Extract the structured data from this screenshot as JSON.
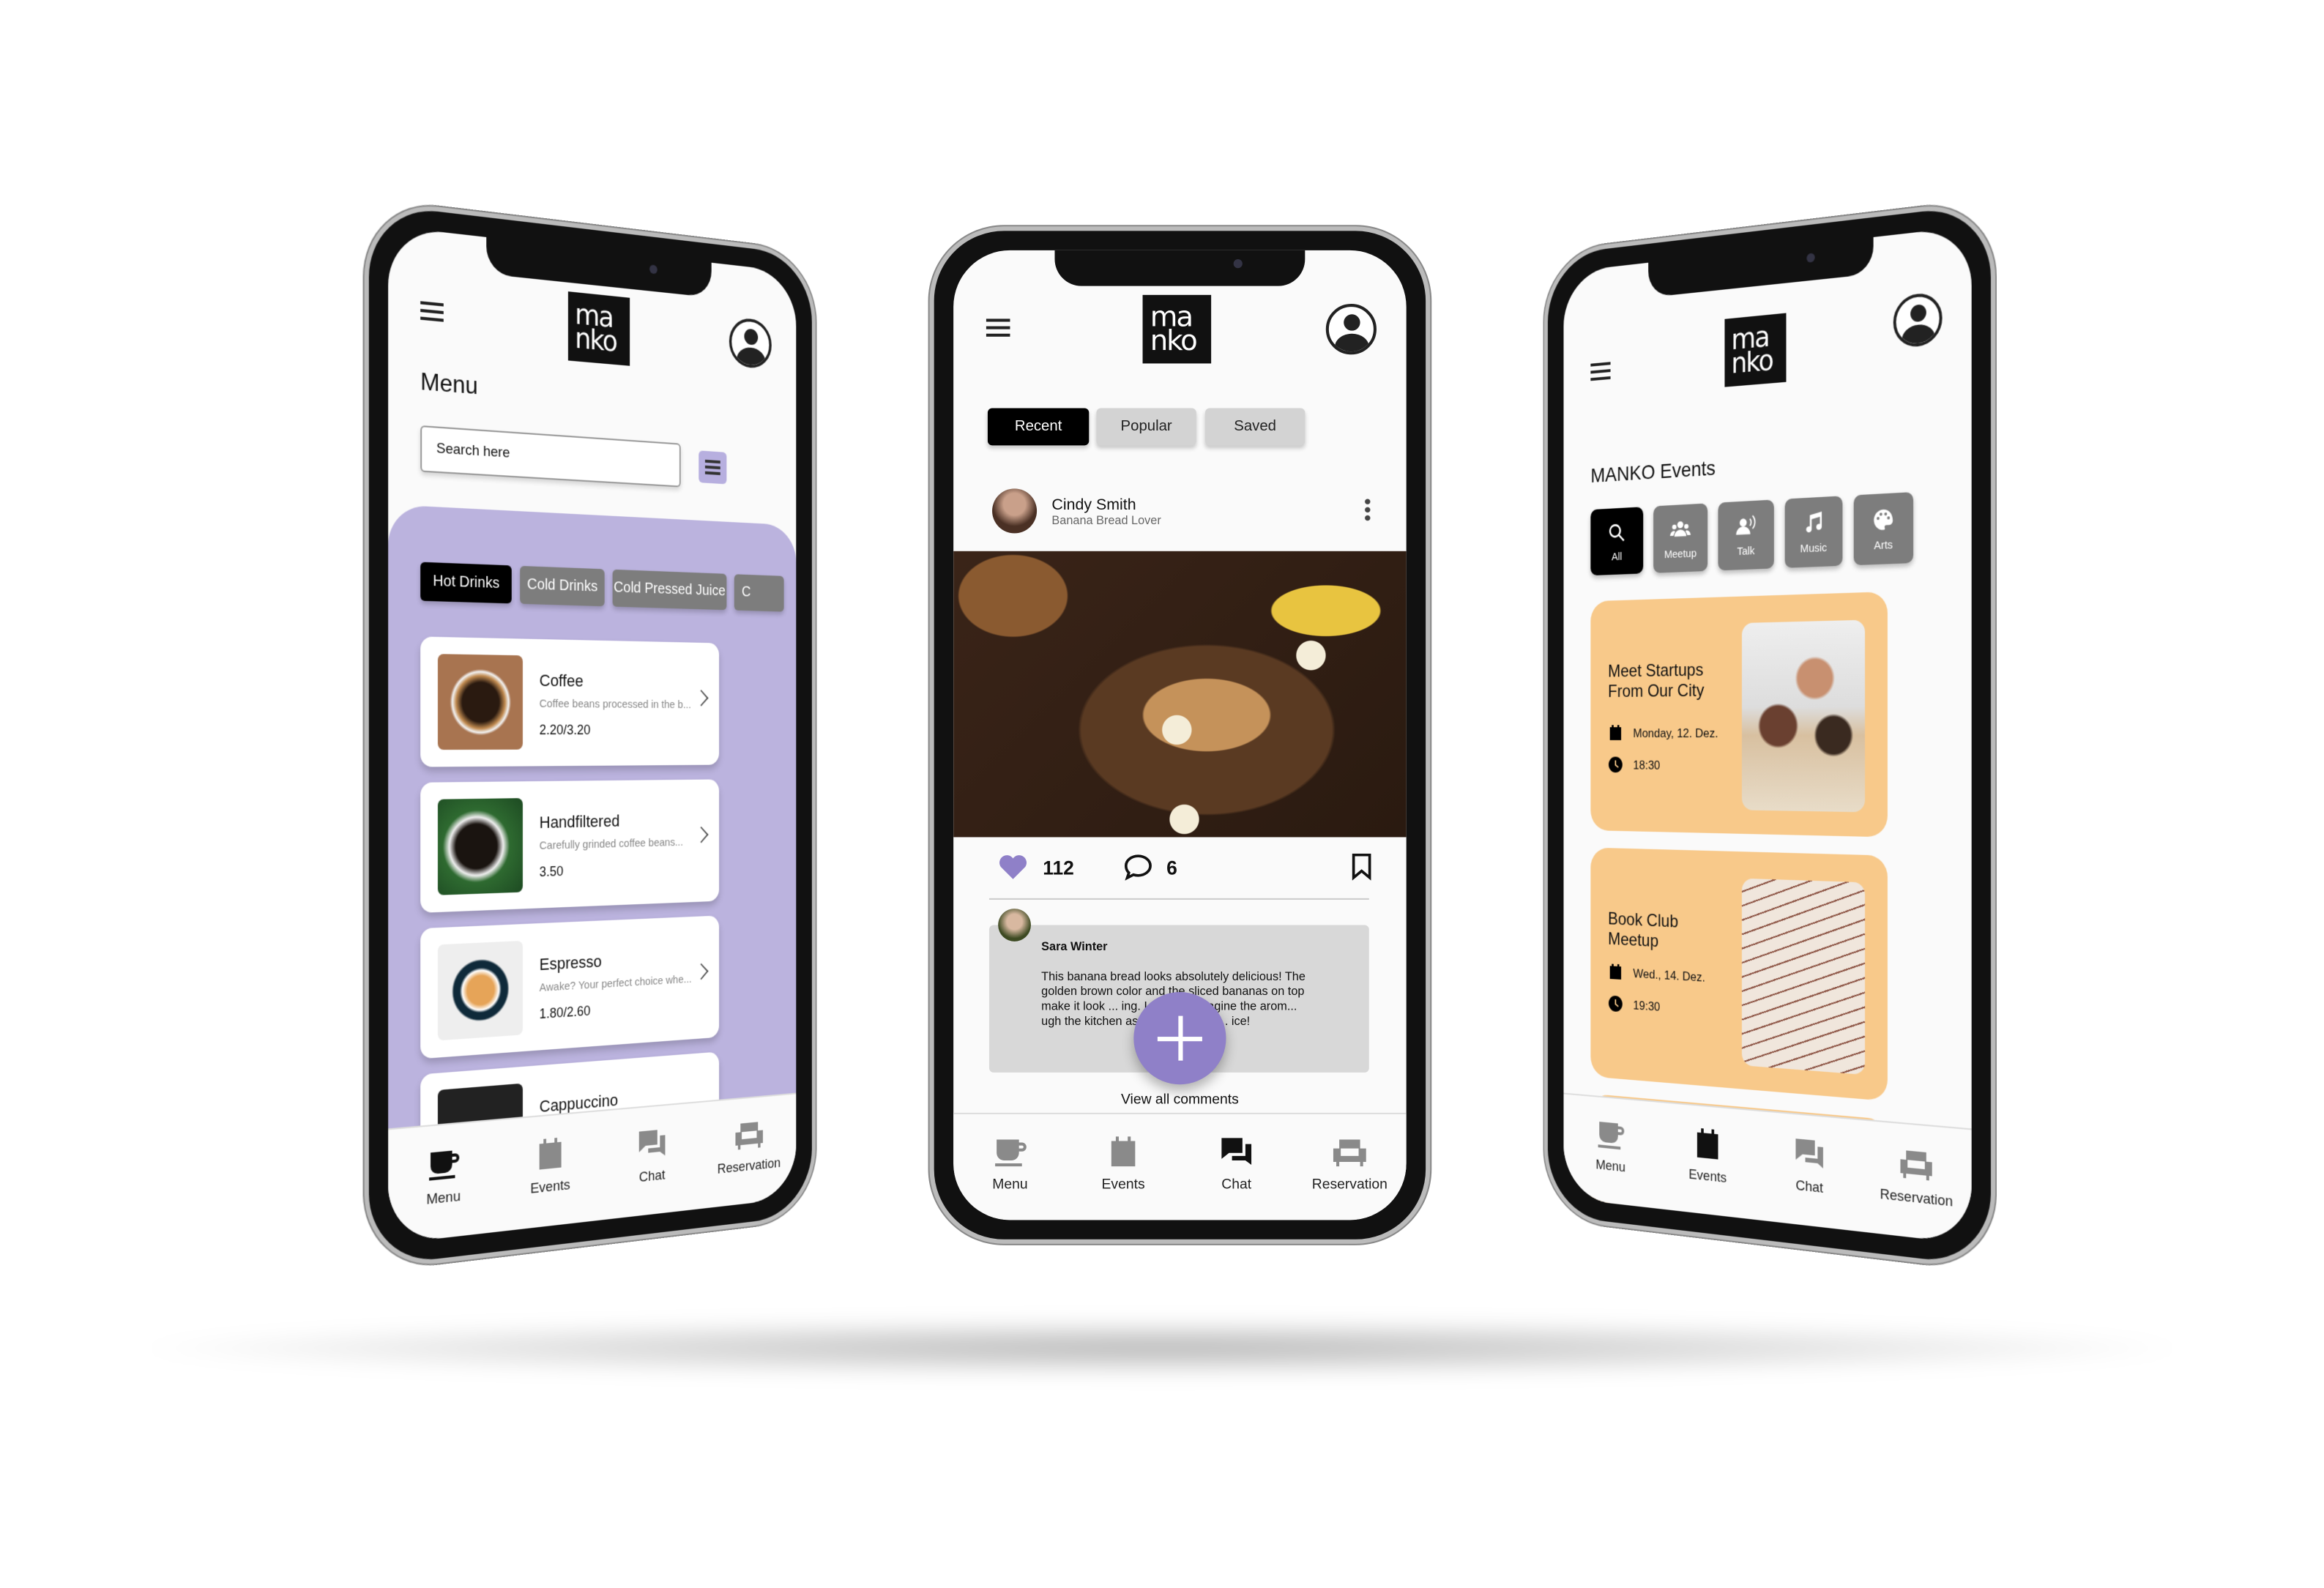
{
  "brand": {
    "logo": "ma nko"
  },
  "nav": [
    "Menu",
    "Events",
    "Chat",
    "Reservation"
  ],
  "left": {
    "title": "Menu",
    "search_placeholder": "Search here",
    "tabs": [
      "Hot Drinks",
      "Cold Drinks",
      "Cold Pressed Juice",
      "C"
    ],
    "items": [
      {
        "name": "Coffee",
        "desc": "Coffee beans processed in the b...",
        "price": "2.20/3.20"
      },
      {
        "name": "Handfiltered",
        "desc": "Carefully grinded coffee beans...",
        "price": "3.50"
      },
      {
        "name": "Espresso",
        "desc": "Awake? Your perfect choice whe...",
        "price": "1.80/2.60"
      },
      {
        "name": "Cappuccino"
      }
    ],
    "active_nav": "Menu"
  },
  "center": {
    "tabs": [
      "Recent",
      "Popular",
      "Saved"
    ],
    "active_tab": "Recent",
    "post": {
      "author": "Cindy Smith",
      "subtitle": "Banana Bread Lover",
      "likes": "112",
      "comments": "6"
    },
    "comment": {
      "author": "Sara Winter",
      "text": "This banana bread looks absolutely delicious! The golden brown color and the sliced bananas on top make it look ... ing. I can just imagine the arom... ugh the kitchen as it bakes. I can ... ice!"
    },
    "view_all": "View all comments",
    "active_nav": "Chat"
  },
  "right": {
    "title": "MANKO Events",
    "categories": [
      "All",
      "Meetup",
      "Talk",
      "Music",
      "Arts"
    ],
    "events": [
      {
        "title": "Meet Startups From Our City",
        "date": "Monday, 12. Dez.",
        "time": "18:30"
      },
      {
        "title": "Book Club Meetup",
        "date": "Wed., 14. Dez.",
        "time": "19:30"
      }
    ],
    "active_nav": "Events"
  },
  "colors": {
    "lavender": "#bbb3de",
    "fab": "#8f80c8",
    "event_card": "#f8c98a",
    "active": "#000000",
    "inactive": "#7d7d7d"
  }
}
